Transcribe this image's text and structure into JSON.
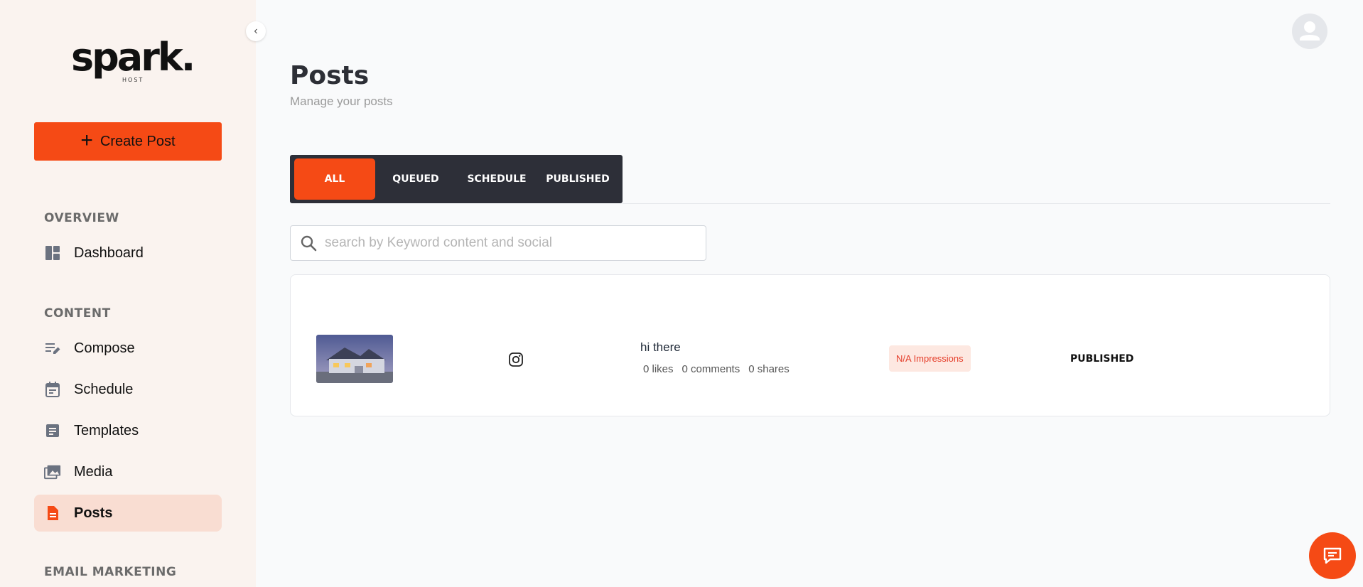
{
  "brand": {
    "logo_text": "spark.",
    "logo_sub": "HOST",
    "accent_color": "#f54a15"
  },
  "sidebar": {
    "create_button": "Create Post",
    "sections": [
      {
        "label": "OVERVIEW"
      },
      {
        "label": "CONTENT"
      },
      {
        "label": "EMAIL MARKETING"
      }
    ],
    "items": [
      {
        "label": "Dashboard",
        "icon": "dashboard-icon"
      },
      {
        "label": "Compose",
        "icon": "compose-icon"
      },
      {
        "label": "Schedule",
        "icon": "calendar-icon"
      },
      {
        "label": "Templates",
        "icon": "document-icon"
      },
      {
        "label": "Media",
        "icon": "images-icon"
      },
      {
        "label": "Posts",
        "icon": "file-icon",
        "active": true
      }
    ]
  },
  "header": {
    "title": "Posts",
    "subtitle": "Manage your posts"
  },
  "tabs": [
    {
      "label": "ALL",
      "active": true
    },
    {
      "label": "QUEUED"
    },
    {
      "label": "SCHEDULE"
    },
    {
      "label": "PUBLISHED"
    }
  ],
  "search": {
    "placeholder": "search by Keyword content and social"
  },
  "posts": [
    {
      "text": "hi there",
      "platform": "instagram",
      "likes": "0 likes",
      "comments": "0 comments",
      "shares": "0 shares",
      "impressions": "N/A Impressions",
      "status": "PUBLISHED"
    }
  ]
}
